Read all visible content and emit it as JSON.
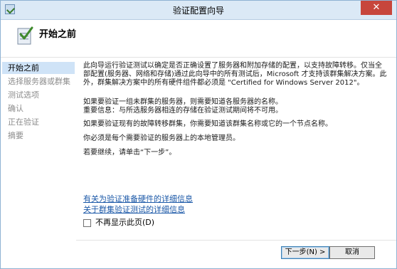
{
  "window": {
    "title": "验证配置向导",
    "close_label": "✕"
  },
  "header": {
    "title": "开始之前"
  },
  "nav": {
    "items": [
      {
        "label": "开始之前",
        "active": true
      },
      {
        "label": "选择服务器或群集",
        "active": false
      },
      {
        "label": "测试选项",
        "active": false
      },
      {
        "label": "确认",
        "active": false
      },
      {
        "label": "正在验证",
        "active": false
      },
      {
        "label": "摘要",
        "active": false
      }
    ]
  },
  "content": {
    "paragraphs": [
      "此向导运行验证测试以确定是否正确设置了服务器和附加存储的配置，以支持故障转移。仅当全部配置(服务器、网络和存储)通过此向导中的所有测试后，Microsoft 才支持该群集解决方案。此外，群集解决方案中的所有硬件组件都必须是 \"Certified for Windows Server 2012\"。",
      "如果要验证一组未群集的服务器，则需要知道各服务器的名称。",
      "重要信息：与所选服务器相连的存储在验证测试期间将不可用。",
      "如果要验证现有的故障转移群集，你需要知道该群集名称或它的一个节点名称。",
      "你必须是每个需要验证的服务器上的本地管理员。",
      "若要继续，请单击“下一步”。"
    ],
    "links": [
      "有关为验证准备硬件的详细信息",
      "关于群集验证测试的详细信息"
    ],
    "checkbox_label": "不再显示此页(D)"
  },
  "buttons": {
    "next_label": "下一步(N) >",
    "cancel_label": "取消"
  },
  "colors": {
    "titlebar": "#dbe9f6",
    "nav_active": "#cfe3f7",
    "link": "#1c59a8",
    "close": "#c7463c"
  }
}
